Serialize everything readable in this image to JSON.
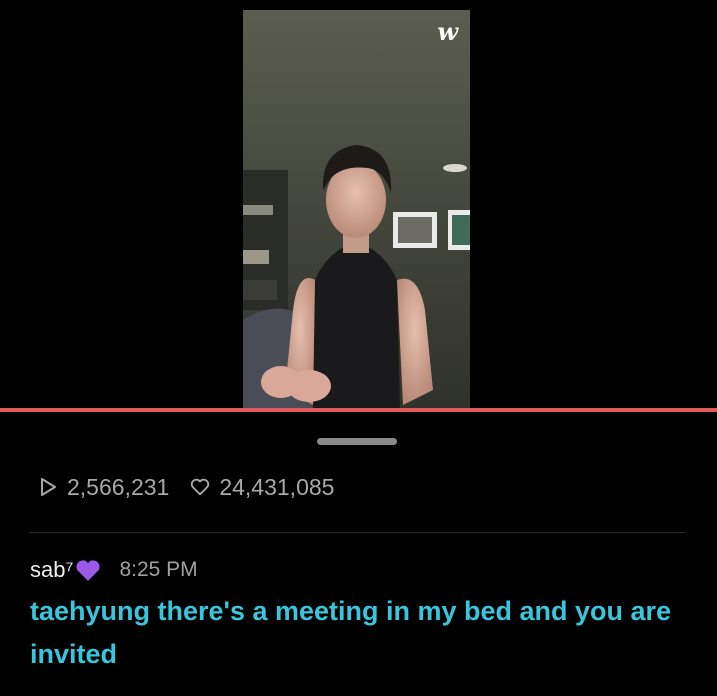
{
  "video": {
    "logo_text": "w",
    "progress_percent": 100,
    "progress_color": "#e05a5a"
  },
  "stats": {
    "plays": "2,566,231",
    "likes": "24,431,085",
    "play_icon": "play-outline-icon",
    "like_icon": "heart-outline-icon"
  },
  "comment": {
    "username": "sab⁷",
    "badge_icon": "purple-heart-icon",
    "badge_color": "#9b59e8",
    "time": "8:25 PM",
    "text": "taehyung there's a meeting in my bed and you are invited",
    "text_color": "#39c6dc"
  }
}
